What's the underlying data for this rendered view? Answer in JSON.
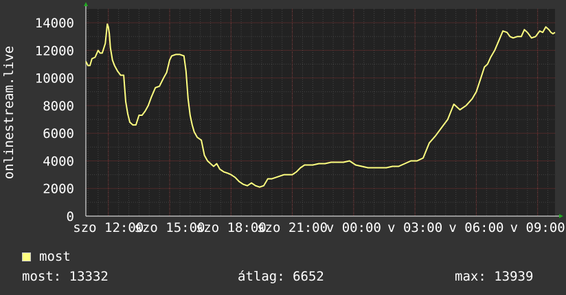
{
  "chart_data": {
    "type": "line",
    "ylabel": "onlinestream.live",
    "ylim": [
      0,
      15000
    ],
    "yticks": [
      0,
      2000,
      4000,
      6000,
      8000,
      10000,
      12000,
      14000
    ],
    "xlabels": [
      "szo 12:00",
      "szo 15:00",
      "szo 18:00",
      "szo 21:00",
      "v 00:00",
      "v 03:00",
      "v 06:00",
      "v 09:00"
    ],
    "grid": true,
    "colors": {
      "background": "#333333",
      "plot": "#222222",
      "grid_major": "#7a3030",
      "grid_minor": "#444444",
      "line": "#ffff80",
      "axis": "#ffffff"
    },
    "series": [
      {
        "name": "most",
        "color": "#ffff80",
        "x": [
          10.9,
          11.0,
          11.1,
          11.2,
          11.35,
          11.5,
          11.6,
          11.7,
          11.85,
          11.95,
          12.0,
          12.05,
          12.1,
          12.2,
          12.3,
          12.45,
          12.6,
          12.75,
          12.85,
          12.95,
          13.05,
          13.2,
          13.35,
          13.5,
          13.65,
          13.8,
          13.95,
          14.1,
          14.3,
          14.5,
          14.7,
          14.85,
          15.0,
          15.1,
          15.3,
          15.5,
          15.7,
          15.8,
          15.9,
          16.0,
          16.1,
          16.2,
          16.35,
          16.55,
          16.7,
          16.85,
          17.0,
          17.15,
          17.3,
          17.45,
          17.65,
          17.85,
          18.0,
          18.2,
          18.4,
          18.6,
          18.8,
          19.0,
          19.2,
          19.4,
          19.6,
          19.8,
          20.0,
          20.2,
          20.4,
          20.6,
          20.8,
          21.0,
          21.2,
          21.4,
          21.6,
          21.8,
          22.0,
          22.3,
          22.6,
          22.9,
          23.2,
          23.5,
          23.8,
          24.1,
          24.4,
          24.7,
          25.0,
          25.3,
          25.6,
          25.9,
          26.2,
          26.5,
          26.8,
          27.1,
          27.4,
          27.7,
          28.0,
          28.3,
          28.6,
          28.9,
          29.2,
          29.5,
          29.8,
          30.0,
          30.2,
          30.4,
          30.55,
          30.7,
          30.9,
          31.1,
          31.3,
          31.5,
          31.65,
          31.8,
          32.0,
          32.2,
          32.35,
          32.5,
          32.7,
          32.9,
          33.1,
          33.25,
          33.4,
          33.55,
          33.65,
          33.75,
          33.85
        ],
        "y": [
          11200,
          10900,
          10900,
          11400,
          11500,
          12000,
          11800,
          11800,
          12500,
          13900,
          13700,
          13200,
          12200,
          11300,
          10900,
          10500,
          10200,
          10200,
          8300,
          7400,
          6800,
          6600,
          6600,
          7300,
          7300,
          7600,
          8000,
          8600,
          9300,
          9400,
          10000,
          10400,
          11300,
          11600,
          11700,
          11700,
          11600,
          10500,
          8500,
          7300,
          6600,
          6100,
          5700,
          5500,
          4400,
          4000,
          3800,
          3600,
          3800,
          3400,
          3200,
          3100,
          3000,
          2800,
          2500,
          2300,
          2200,
          2400,
          2200,
          2100,
          2200,
          2700,
          2700,
          2800,
          2900,
          3000,
          3000,
          3000,
          3200,
          3500,
          3700,
          3700,
          3700,
          3800,
          3800,
          3900,
          3900,
          3900,
          4000,
          3700,
          3600,
          3500,
          3500,
          3500,
          3500,
          3600,
          3600,
          3800,
          4000,
          4000,
          4200,
          5300,
          5800,
          6400,
          7000,
          8100,
          7700,
          8000,
          8500,
          9000,
          9900,
          10800,
          11000,
          11500,
          12000,
          12700,
          13400,
          13300,
          13000,
          12900,
          13000,
          13000,
          13500,
          13300,
          12900,
          13000,
          13400,
          13300,
          13700,
          13500,
          13300,
          13200,
          13300
        ]
      }
    ],
    "xrange": [
      10.9,
      33.85
    ]
  },
  "legend": {
    "label": "most",
    "color": "#ffff80"
  },
  "stats": {
    "current": "most: 13332",
    "average": "átlag: 6652",
    "max": "max: 13939"
  }
}
